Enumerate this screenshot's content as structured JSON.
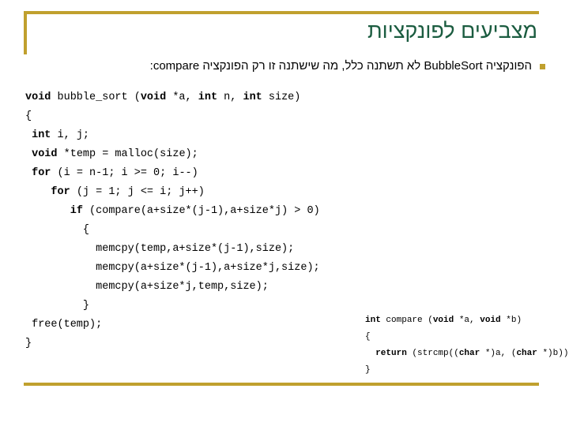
{
  "slide": {
    "title": "מצביעים לפונקציות",
    "bullet": {
      "marker": "square-bullet",
      "text": "הפונקציה BubbleSort לא תשתנה כלל, מה שישתנה זו רק הפונקציה compare:"
    },
    "colors": {
      "accent_gold": "#c0a02e",
      "title_green": "#1b5c40",
      "code_text": "#000000",
      "background": "#ffffff"
    }
  },
  "code_main": {
    "language": "c",
    "lines": [
      [
        {
          "t": "void",
          "b": true
        },
        {
          "t": " bubble_sort (",
          "b": false
        },
        {
          "t": "void",
          "b": true
        },
        {
          "t": " *a, ",
          "b": false
        },
        {
          "t": "int",
          "b": true
        },
        {
          "t": " n, ",
          "b": false
        },
        {
          "t": "int",
          "b": true
        },
        {
          "t": " size)",
          "b": false
        }
      ],
      [
        {
          "t": "{",
          "b": false
        }
      ],
      [
        {
          "t": " ",
          "b": false
        },
        {
          "t": "int",
          "b": true
        },
        {
          "t": " i, j;",
          "b": false
        }
      ],
      [
        {
          "t": " ",
          "b": false
        },
        {
          "t": "void",
          "b": true
        },
        {
          "t": " *temp = malloc(size);",
          "b": false
        }
      ],
      [
        {
          "t": " ",
          "b": false
        },
        {
          "t": "for",
          "b": true
        },
        {
          "t": " (i = n-1; i >= 0; i--)",
          "b": false
        }
      ],
      [
        {
          "t": "    ",
          "b": false
        },
        {
          "t": "for",
          "b": true
        },
        {
          "t": " (j = 1; j <= i; j++)",
          "b": false
        }
      ],
      [
        {
          "t": "       ",
          "b": false
        },
        {
          "t": "if",
          "b": true
        },
        {
          "t": " (compare(a+size*(j-1),a+size*j) > 0)",
          "b": false
        }
      ],
      [
        {
          "t": "         {",
          "b": false
        }
      ],
      [
        {
          "t": "           memcpy(temp,a+size*(j-1),size);",
          "b": false
        }
      ],
      [
        {
          "t": "           memcpy(a+size*(j-1),a+size*j,size);",
          "b": false
        }
      ],
      [
        {
          "t": "           memcpy(a+size*j,temp,size);",
          "b": false
        }
      ],
      [
        {
          "t": "         }",
          "b": false
        }
      ],
      [
        {
          "t": " free(temp);",
          "b": false
        }
      ],
      [
        {
          "t": "}",
          "b": false
        }
      ]
    ]
  },
  "code_compare": {
    "language": "c",
    "lines": [
      [
        {
          "t": "int",
          "b": true
        },
        {
          "t": " compare (",
          "b": false
        },
        {
          "t": "void",
          "b": true
        },
        {
          "t": " *a, ",
          "b": false
        },
        {
          "t": "void",
          "b": true
        },
        {
          "t": " *b)",
          "b": false
        }
      ],
      [
        {
          "t": "{",
          "b": false
        }
      ],
      [
        {
          "t": "  ",
          "b": false
        },
        {
          "t": "return",
          "b": true
        },
        {
          "t": " (strcmp((",
          "b": false
        },
        {
          "t": "char",
          "b": true
        },
        {
          "t": " *)a, (",
          "b": false
        },
        {
          "t": "char",
          "b": true
        },
        {
          "t": " *)b));",
          "b": false
        }
      ],
      [
        {
          "t": "}",
          "b": false
        }
      ]
    ]
  }
}
